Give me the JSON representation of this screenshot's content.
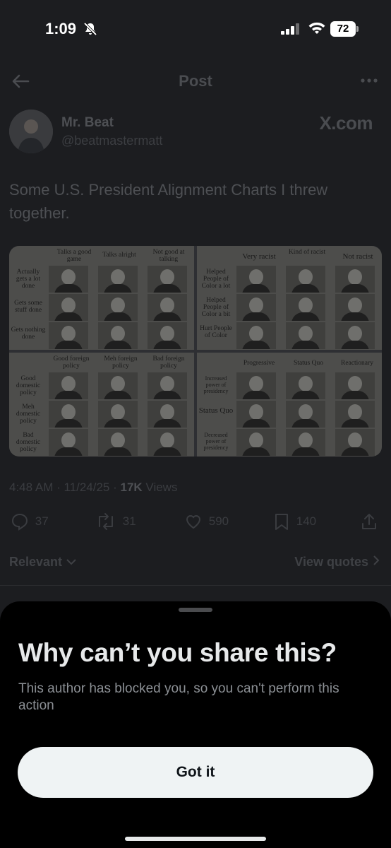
{
  "status_bar": {
    "time": "1:09",
    "battery": "72"
  },
  "nav": {
    "title": "Post"
  },
  "post": {
    "author_name": "Mr. Beat",
    "author_handle": "@beatmastermatt",
    "source_logo": "X.com",
    "text": "Some U.S. President Alignment Charts I threw together.",
    "timestamp": "4:48 AM · 11/24/25 · ",
    "views_count": "17K",
    "views_label": " Views",
    "replies": "37",
    "reposts": "31",
    "likes": "590",
    "bookmarks": "140"
  },
  "media": {
    "panel1": {
      "cols": [
        "Talks a good game",
        "Talks alright",
        "Not good at talking"
      ],
      "rows": [
        "Actually gets a lot done",
        "Gets some stuff done",
        "Gets nothing done"
      ]
    },
    "panel2": {
      "cols": [
        "Very racist",
        "Kind of racist",
        "Not racist"
      ],
      "rows": [
        "Helped People of Color a lot",
        "Helped People of Color a bit",
        "Hurt People of Color"
      ]
    },
    "panel3": {
      "cols": [
        "Good foreign policy",
        "Meh foreign policy",
        "Bad foreign policy"
      ],
      "rows": [
        "Good domestic policy",
        "Meh domestic policy",
        "Bad domestic policy"
      ]
    },
    "panel4": {
      "cols": [
        "Progressive",
        "Status Quo",
        "Reactionary"
      ],
      "rows": [
        "Increased power of presidency",
        "Status Quo",
        "Decreased power of presidency"
      ]
    }
  },
  "replies_bar": {
    "sort_label": "Relevant",
    "view_quotes": "View quotes"
  },
  "sheet": {
    "title": "Why can’t you share this?",
    "body": "This author has blocked you, so you can't perform this action",
    "button": "Got it"
  },
  "colors": {
    "sheet_bg": "#000000",
    "button_bg": "#eff3f4",
    "dim_bg": "#1c1d20"
  }
}
